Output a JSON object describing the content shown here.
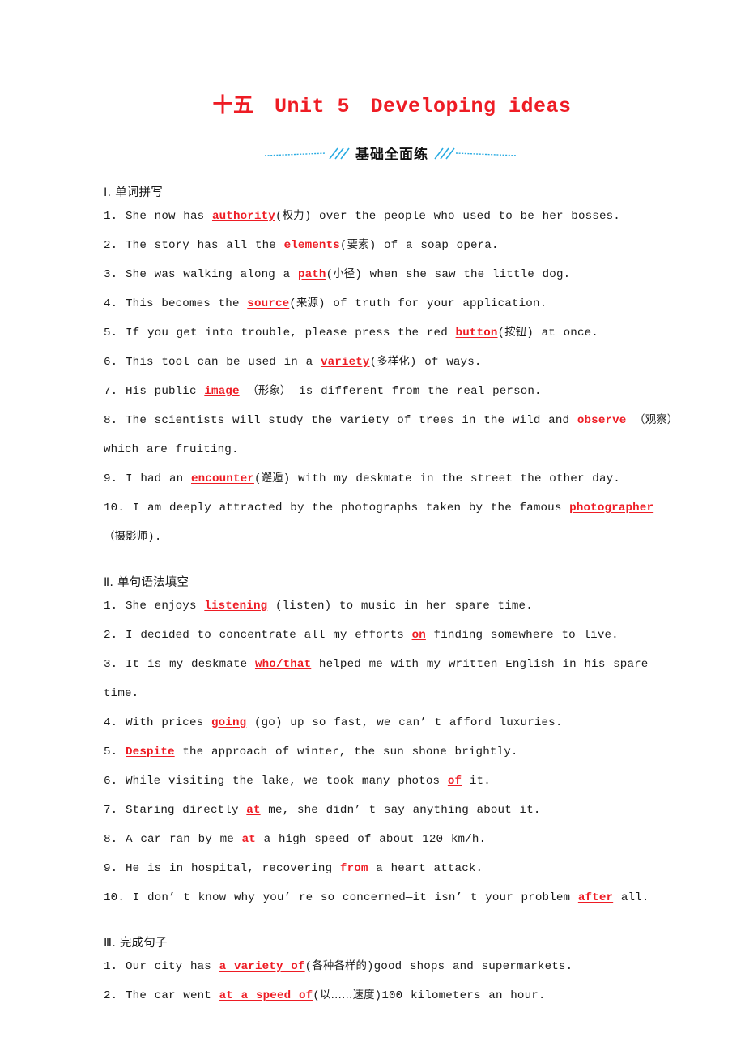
{
  "doc": {
    "title": "十五　Unit 5　Developing ideas",
    "banner": {
      "label": "基础全面练",
      "line_color": "#29abe2",
      "slash_color": "#29abe2"
    },
    "accent_color": "#ee1c24",
    "text_color": "#1a1a1a"
  },
  "sections": [
    {
      "heading": "Ⅰ. 单词拼写",
      "items": [
        {
          "number": "1.",
          "parts": [
            {
              "t": "She now has ",
              "style": "plain"
            },
            {
              "t": "authority",
              "style": "answer"
            },
            {
              "t": "(权力) over the people who used to be her bosses.",
              "style": "plain"
            }
          ]
        },
        {
          "number": "2.",
          "parts": [
            {
              "t": "The story has all the ",
              "style": "plain"
            },
            {
              "t": "elements",
              "style": "answer"
            },
            {
              "t": "(要素) of a soap opera.",
              "style": "plain"
            }
          ]
        },
        {
          "number": "3.",
          "parts": [
            {
              "t": "She was walking along a ",
              "style": "plain"
            },
            {
              "t": "path",
              "style": "answer"
            },
            {
              "t": "(小径) when she saw the little dog.",
              "style": "plain"
            }
          ]
        },
        {
          "number": "4.",
          "parts": [
            {
              "t": "This becomes the ",
              "style": "plain"
            },
            {
              "t": "source",
              "style": "answer"
            },
            {
              "t": "(来源) of truth for your application.",
              "style": "plain"
            }
          ]
        },
        {
          "number": "5.",
          "parts": [
            {
              "t": "If you get into trouble, please press the red ",
              "style": "plain"
            },
            {
              "t": "button",
              "style": "answer"
            },
            {
              "t": "(按钮) at once.",
              "style": "plain"
            }
          ]
        },
        {
          "number": "6.",
          "parts": [
            {
              "t": "This tool can be used in a ",
              "style": "plain"
            },
            {
              "t": "variety",
              "style": "answer"
            },
            {
              "t": "(多样化) of ways.",
              "style": "plain"
            }
          ]
        },
        {
          "number": "7.",
          "parts": [
            {
              "t": "His public ",
              "style": "plain"
            },
            {
              "t": "image",
              "style": "answer"
            },
            {
              "t": " （形象） is different from the real person.",
              "style": "plain"
            }
          ]
        },
        {
          "number": "8.",
          "parts": [
            {
              "t": "The scientists will study the variety of trees in the wild and ",
              "style": "plain"
            },
            {
              "t": "observe",
              "style": "answer"
            },
            {
              "t": " （观察） which are fruiting.",
              "style": "plain"
            }
          ]
        },
        {
          "number": "9.",
          "parts": [
            {
              "t": "I had an ",
              "style": "plain"
            },
            {
              "t": "encounter",
              "style": "answer"
            },
            {
              "t": "(邂逅) with my deskmate in the street the other day.",
              "style": "plain"
            }
          ]
        },
        {
          "number": "10.",
          "parts": [
            {
              "t": "I am deeply attracted by the photographs taken by the famous ",
              "style": "plain"
            },
            {
              "t": "photographer",
              "style": "answer"
            },
            {
              "t": " （摄影师).",
              "style": "plain"
            }
          ]
        }
      ]
    },
    {
      "heading": "Ⅱ. 单句语法填空",
      "items": [
        {
          "number": "1.",
          "parts": [
            {
              "t": "She enjoys ",
              "style": "plain"
            },
            {
              "t": "listening",
              "style": "answer"
            },
            {
              "t": " (listen) to music in her spare time.",
              "style": "plain"
            }
          ]
        },
        {
          "number": "2.",
          "parts": [
            {
              "t": "I decided to concentrate all my efforts ",
              "style": "plain"
            },
            {
              "t": "on",
              "style": "answer"
            },
            {
              "t": " finding somewhere to live.",
              "style": "plain"
            }
          ]
        },
        {
          "number": "3.",
          "parts": [
            {
              "t": "It is my deskmate ",
              "style": "plain"
            },
            {
              "t": "who/that",
              "style": "answer"
            },
            {
              "t": " helped me with my written English in his spare time.",
              "style": "plain"
            }
          ]
        },
        {
          "number": "4.",
          "parts": [
            {
              "t": "With prices ",
              "style": "plain"
            },
            {
              "t": "going",
              "style": "answer"
            },
            {
              "t": " (go) up so fast,  we can’ t afford luxuries.",
              "style": "plain"
            }
          ]
        },
        {
          "number": "5.",
          "parts": [
            {
              "t": "Despite",
              "style": "answer"
            },
            {
              "t": " the approach of winter,  the sun shone brightly.",
              "style": "plain"
            }
          ]
        },
        {
          "number": "6.",
          "parts": [
            {
              "t": "While visiting the lake,  we took many photos ",
              "style": "plain"
            },
            {
              "t": "of",
              "style": "answer"
            },
            {
              "t": " it.",
              "style": "plain"
            }
          ]
        },
        {
          "number": "7.",
          "parts": [
            {
              "t": "Staring directly ",
              "style": "plain"
            },
            {
              "t": "at",
              "style": "answer"
            },
            {
              "t": " me,  she didn’ t say anything about it.",
              "style": "plain"
            }
          ]
        },
        {
          "number": "8.",
          "parts": [
            {
              "t": "A car ran by me ",
              "style": "plain"
            },
            {
              "t": "at",
              "style": "answer"
            },
            {
              "t": " a high speed of about 120 km/h.",
              "style": "plain"
            }
          ]
        },
        {
          "number": "9.",
          "parts": [
            {
              "t": "He is in hospital,  recovering ",
              "style": "plain"
            },
            {
              "t": "from",
              "style": "answer"
            },
            {
              "t": " a heart attack.",
              "style": "plain"
            }
          ]
        },
        {
          "number": "10.",
          "parts": [
            {
              "t": "I don’ t know why you’ re so concerned—it isn’ t your problem ",
              "style": "plain"
            },
            {
              "t": "after",
              "style": "answer"
            },
            {
              "t": " all.",
              "style": "plain"
            }
          ]
        }
      ]
    },
    {
      "heading": "Ⅲ. 完成句子",
      "items": [
        {
          "number": "1.",
          "parts": [
            {
              "t": "Our city has ",
              "style": "plain"
            },
            {
              "t": "a variety of",
              "style": "answer"
            },
            {
              "t": "(各种各样的)good shops and supermarkets.",
              "style": "plain"
            }
          ]
        },
        {
          "number": "2.",
          "parts": [
            {
              "t": "The car went ",
              "style": "plain"
            },
            {
              "t": "at a speed of",
              "style": "answer"
            },
            {
              "t": "(以……速度)100 kilometers an hour.",
              "style": "plain"
            }
          ]
        }
      ]
    }
  ]
}
